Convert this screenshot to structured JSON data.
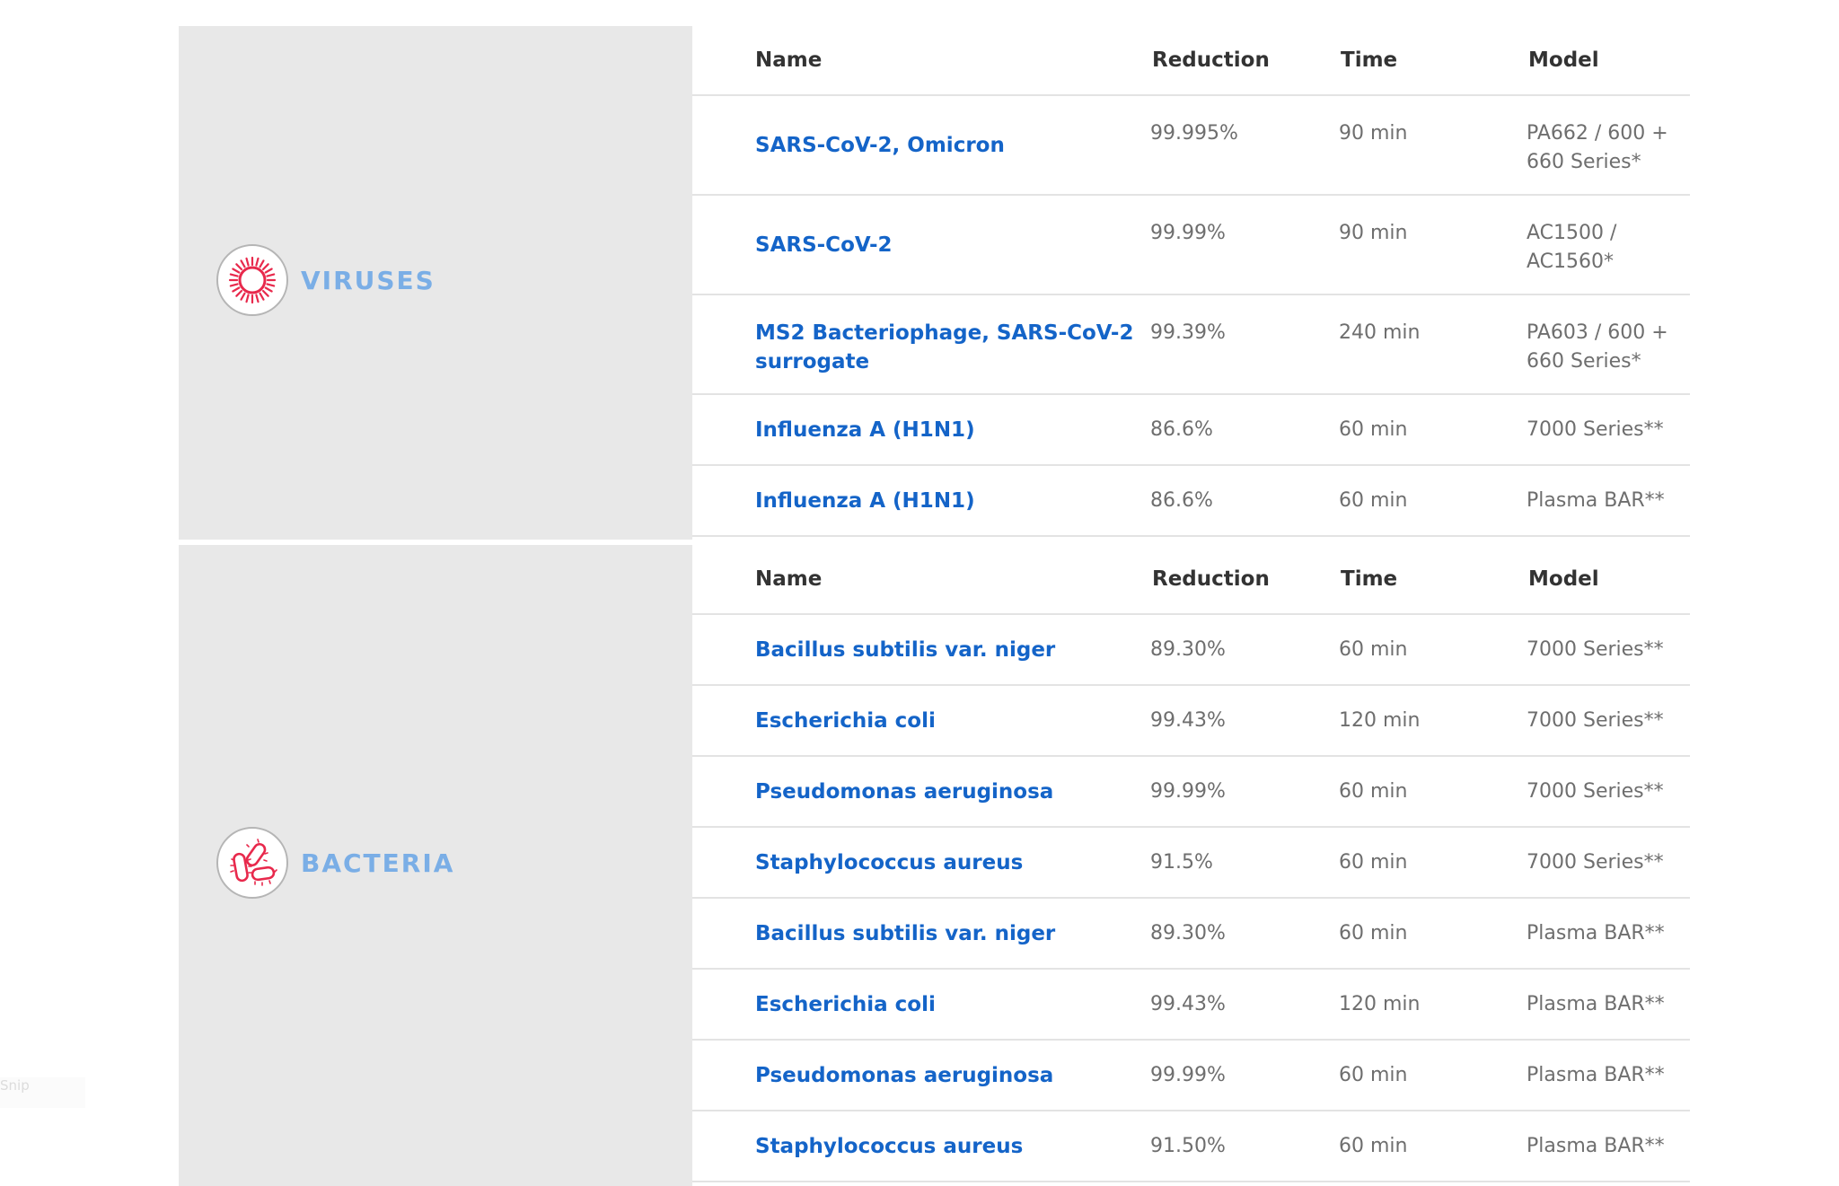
{
  "columns": {
    "name": "Name",
    "reduction": "Reduction",
    "time": "Time",
    "model": "Model"
  },
  "viruses": {
    "label": "VIRUSES",
    "icon": "virus-icon",
    "accent": "#e8294c",
    "rows": [
      {
        "name": "SARS-CoV-2, Omicron",
        "reduction": "99.995%",
        "time": "90 min",
        "model": "PA662 / 600 + 660 Series*"
      },
      {
        "name": "SARS-CoV-2",
        "reduction": "99.99%",
        "time": "90 min",
        "model": "AC1500 / AC1560*"
      },
      {
        "name": "MS2 Bacteriophage, SARS-CoV-2 surrogate",
        "reduction": "99.39%",
        "time": "240 min",
        "model": "PA603 / 600 + 660 Series*"
      },
      {
        "name": "Influenza A (H1N1)",
        "reduction": "86.6%",
        "time": "60 min",
        "model": "7000 Series**"
      },
      {
        "name": "Influenza A (H1N1)",
        "reduction": "86.6%",
        "time": "60 min",
        "model": "Plasma BAR**"
      }
    ]
  },
  "bacteria": {
    "label": "BACTERIA",
    "icon": "bacteria-icon",
    "accent": "#e8294c",
    "rows": [
      {
        "name": "Bacillus subtilis var. niger",
        "reduction": "89.30%",
        "time": "60 min",
        "model": "7000 Series**"
      },
      {
        "name": "Escherichia coli",
        "reduction": "99.43%",
        "time": "120 min",
        "model": "7000 Series**"
      },
      {
        "name": "Pseudomonas aeruginosa",
        "reduction": "99.99%",
        "time": "60 min",
        "model": "7000 Series**"
      },
      {
        "name": "Staphylococcus aureus",
        "reduction": "91.5%",
        "time": "60 min",
        "model": "7000 Series**"
      },
      {
        "name": "Bacillus subtilis var. niger",
        "reduction": "89.30%",
        "time": "60 min",
        "model": "Plasma BAR**"
      },
      {
        "name": "Escherichia coli",
        "reduction": "99.43%",
        "time": "120 min",
        "model": "Plasma BAR**"
      },
      {
        "name": "Pseudomonas aeruginosa",
        "reduction": "99.99%",
        "time": "60 min",
        "model": "Plasma BAR**"
      },
      {
        "name": "Staphylococcus aureus",
        "reduction": "91.50%",
        "time": "60 min",
        "model": "Plasma BAR**"
      }
    ]
  },
  "colors": {
    "name_link": "#1464c8",
    "category_label": "#7aaee6",
    "panel_bg": "#e8e8e8"
  },
  "hint": "Snip"
}
